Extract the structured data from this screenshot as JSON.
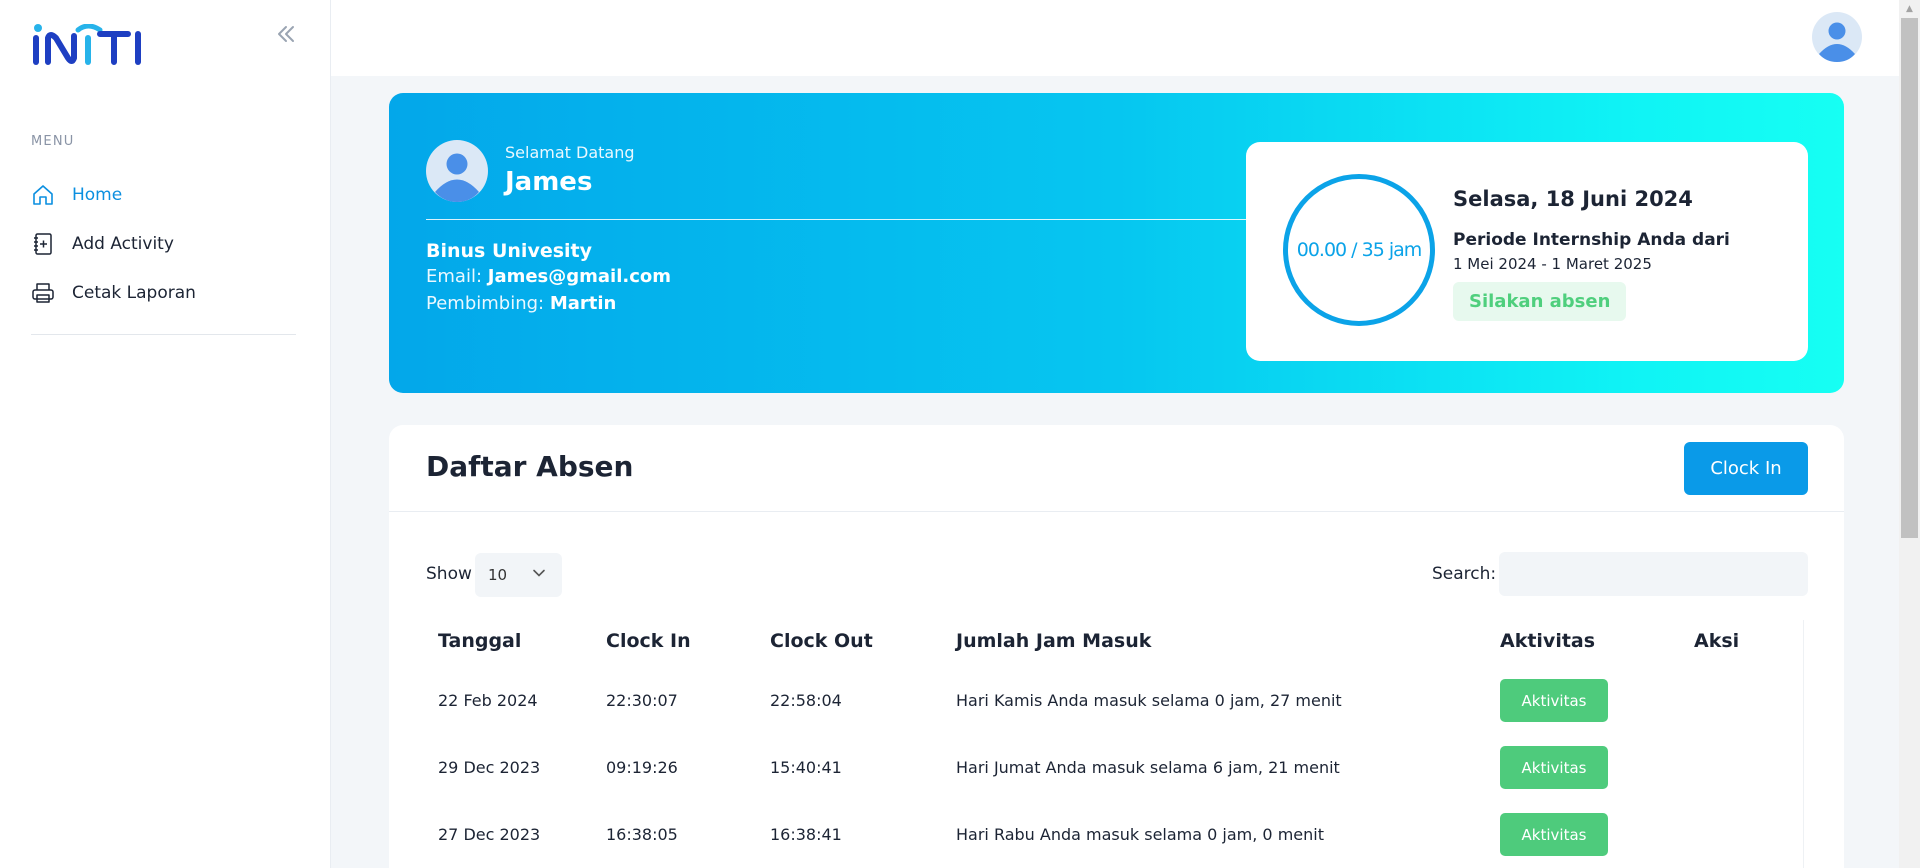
{
  "sidebar": {
    "menu_heading": "MENU",
    "items": [
      {
        "label": "Home",
        "icon": "home-icon"
      },
      {
        "label": "Add Activity",
        "icon": "add-activity-icon"
      },
      {
        "label": "Cetak Laporan",
        "icon": "printer-icon"
      }
    ]
  },
  "colors": {
    "accent": "#0b8fe0",
    "hero_start": "#03a7ea",
    "hero_end": "#16fff3",
    "success": "#4ecb7c",
    "logo_blue": "#1e3fc2",
    "logo_cyan": "#27b3ea"
  },
  "hero": {
    "welcome": "Selamat Datang",
    "name": "James",
    "university": "Binus Univesity",
    "email_label": "Email:",
    "email": "James@gmail.com",
    "supervisor_label": "Pembimbing:",
    "supervisor": "Martin"
  },
  "card": {
    "hours": "00.00 / 35 jam",
    "date": "Selasa, 18 Juni 2024",
    "period_label": "Periode Internship Anda dari",
    "period_range": "1 Mei 2024 - 1 Maret 2025",
    "status": "Silakan absen"
  },
  "panel": {
    "title": "Daftar Absen",
    "clock_in_button": "Clock In",
    "show_label": "Show",
    "show_value": "10",
    "search_label": "Search:",
    "search_value": ""
  },
  "table": {
    "headers": [
      "Tanggal",
      "Clock In",
      "Clock Out",
      "Jumlah Jam Masuk",
      "Aktivitas",
      "Aksi"
    ],
    "rows": [
      {
        "date": "22 Feb 2024",
        "clock_in": "22:30:07",
        "clock_out": "22:58:04",
        "summary": "Hari Kamis Anda masuk selama 0 jam, 27 menit",
        "button": "Aktivitas"
      },
      {
        "date": "29 Dec 2023",
        "clock_in": "09:19:26",
        "clock_out": "15:40:41",
        "summary": "Hari Jumat Anda masuk selama 6 jam, 21 menit",
        "button": "Aktivitas"
      },
      {
        "date": "27 Dec 2023",
        "clock_in": "16:38:05",
        "clock_out": "16:38:41",
        "summary": "Hari Rabu Anda masuk selama 0 jam, 0 menit",
        "button": "Aktivitas"
      }
    ]
  }
}
